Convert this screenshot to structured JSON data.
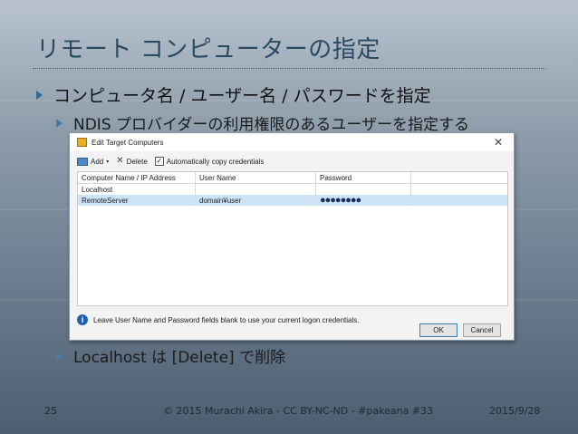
{
  "slide": {
    "title": "リモート コンピューターの指定",
    "bullets": [
      "コンピュータ名 / ユーザー名 / パスワードを指定",
      "NDIS プロバイダーの利用権限のあるユーザーを指定する",
      "Localhost は [Delete] で削除"
    ],
    "footer": {
      "page_number": "25",
      "copyright": "© 2015 Murachi Akira - CC BY-NC-ND - #pakeana #33",
      "date": "2015/9/28"
    }
  },
  "dialog": {
    "title": "Edit Target Computers",
    "close_glyph": "✕",
    "toolbar": {
      "add_label": "Add",
      "add_caret": "▾",
      "delete_glyph": "✕",
      "delete_label": "Delete",
      "copy_check_glyph": "✓",
      "copy_label": "Automatically copy credentials"
    },
    "grid": {
      "columns": [
        "Computer Name / IP Address",
        "User Name",
        "Password"
      ],
      "rows": [
        {
          "computer": "Localhost",
          "user": "",
          "password": "",
          "selected": false
        },
        {
          "computer": "RemoteServer",
          "user": "domain¥user",
          "password": "●●●●●●●●",
          "selected": true
        }
      ]
    },
    "info_glyph": "i",
    "info_text": "Leave User Name and Password fields blank to use your current logon credentials.",
    "ok_label": "OK",
    "cancel_label": "Cancel"
  }
}
